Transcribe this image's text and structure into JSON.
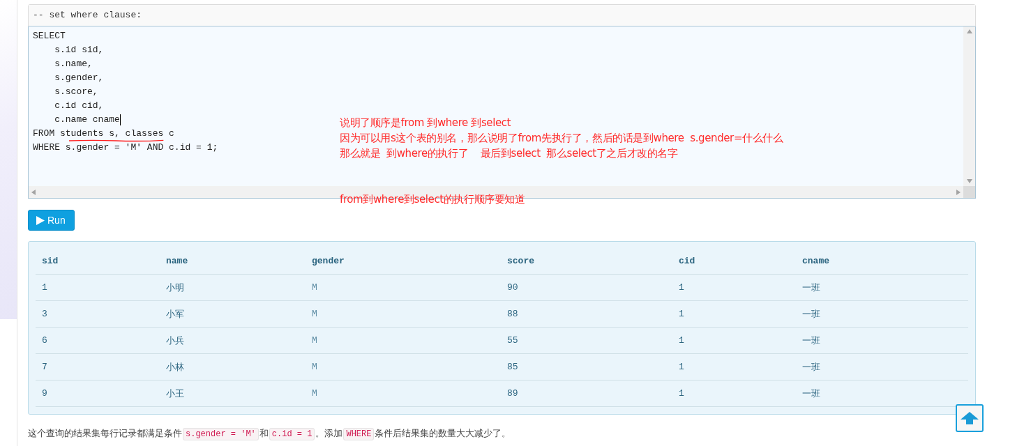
{
  "editor": {
    "header": "-- set where clause:",
    "lines": [
      "SELECT",
      "    s.id sid,",
      "    s.name,",
      "    s.gender,",
      "    s.score,",
      "    c.id cid,",
      "    c.name cname",
      "FROM students s, classes c",
      "WHERE s.gender = 'M' AND c.id = 1;"
    ]
  },
  "notes": [
    [
      "说明了顺序是from 到where 到select",
      "因为可以用s这个表的别名，那么说明了from先执行了，然后的话是到where  s.gender=什么什么",
      "那么就是  到where的执行了    最后到select  那么select了之后才改的名字"
    ],
    [
      "from到where到select的执行顺序要知道"
    ]
  ],
  "run_button": {
    "label": "Run"
  },
  "table": {
    "columns": [
      "sid",
      "name",
      "gender",
      "score",
      "cid",
      "cname"
    ],
    "rows": [
      [
        "1",
        "小明",
        "M",
        "90",
        "1",
        "一班"
      ],
      [
        "3",
        "小军",
        "M",
        "88",
        "1",
        "一班"
      ],
      [
        "6",
        "小兵",
        "M",
        "55",
        "1",
        "一班"
      ],
      [
        "7",
        "小林",
        "M",
        "85",
        "1",
        "一班"
      ],
      [
        "9",
        "小王",
        "M",
        "89",
        "1",
        "一班"
      ]
    ]
  },
  "footer": [
    {
      "kind": "text",
      "text": "这个查询的结果集每行记录都满足条件"
    },
    {
      "kind": "code",
      "text": "s.gender = 'M'"
    },
    {
      "kind": "text",
      "text": "和"
    },
    {
      "kind": "code",
      "text": "c.id = 1"
    },
    {
      "kind": "text",
      "text": "。添加"
    },
    {
      "kind": "code",
      "text": "WHERE"
    },
    {
      "kind": "text",
      "text": "条件后结果集的数量大大减少了。"
    }
  ]
}
